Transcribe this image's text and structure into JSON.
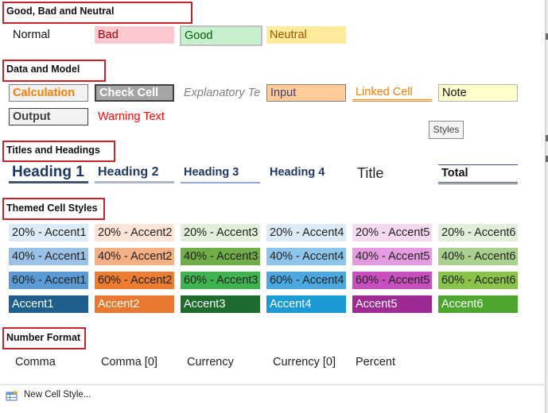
{
  "sections": {
    "good_bad_neutral": "Good, Bad and Neutral",
    "data_model": "Data and Model",
    "titles_headings": "Titles and Headings",
    "themed": "Themed Cell Styles",
    "number_format": "Number Format"
  },
  "good_bad": [
    "Normal",
    "Bad",
    "Good",
    "Neutral"
  ],
  "data_model": [
    "Calculation",
    "Check Cell",
    "Explanatory Te:",
    "Input",
    "Linked Cell",
    "Note",
    "Output",
    "Warning Text"
  ],
  "tooltip": "Styles",
  "headings": [
    "Heading 1",
    "Heading 2",
    "Heading 3",
    "Heading 4",
    "Title",
    "Total"
  ],
  "themed": {
    "row20": [
      "20% - Accent1",
      "20% - Accent2",
      "20% - Accent3",
      "20% - Accent4",
      "20% - Accent5",
      "20% - Accent6"
    ],
    "row40": [
      "40% - Accent1",
      "40% - Accent2",
      "40% - Accent3",
      "40% - Accent4",
      "40% - Accent5",
      "40% - Accent6"
    ],
    "row60": [
      "60% - Accent1",
      "60% - Accent2",
      "60% - Accent3",
      "60% - Accent4",
      "60% - Accent5",
      "60% - Accent6"
    ],
    "accent": [
      "Accent1",
      "Accent2",
      "Accent3",
      "Accent4",
      "Accent5",
      "Accent6"
    ]
  },
  "colors": {
    "row20": [
      "#ddebf7",
      "#fce4d6",
      "#e2efda",
      "#ddebf7",
      "#f4d9f1",
      "#e2efda"
    ],
    "row40": [
      "#9bc2e6",
      "#f4b084",
      "#70ad47",
      "#8ec5ea",
      "#e59be0",
      "#a9d08e"
    ],
    "row60": [
      "#5b9bd5",
      "#ed7d31",
      "#3fb34f",
      "#4ba8e0",
      "#c94fc0",
      "#8bc34a"
    ],
    "accent": [
      "#1f5f8b",
      "#e8782f",
      "#1e6b2e",
      "#1b9ad6",
      "#9e2b94",
      "#4da72e"
    ]
  },
  "number_format": [
    "Comma",
    "Comma [0]",
    "Currency",
    "Currency [0]",
    "Percent"
  ],
  "footer": {
    "new_style": "New Cell Style...",
    "new_style_icon": "new-style-icon"
  }
}
